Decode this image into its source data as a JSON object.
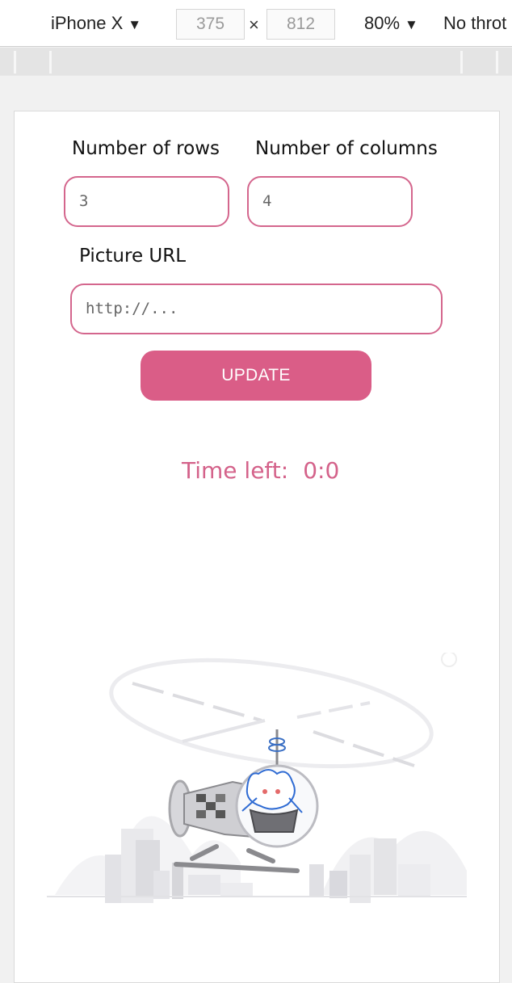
{
  "devtools": {
    "device": "iPhone X",
    "width": "375",
    "height": "812",
    "times": "×",
    "zoom": "80%",
    "throttle": "No throt",
    "caret": "▼"
  },
  "form": {
    "rows_label": "Number of rows",
    "rows_value": "3",
    "cols_label": "Number of columns",
    "cols_value": "4",
    "url_label": "Picture URL",
    "url_placeholder": "http://...",
    "update_label": "UPDATE"
  },
  "timer": {
    "label": "Time left:",
    "value": "0:0"
  },
  "illustration": {
    "icon": "octocat-helicopter-icon"
  },
  "colors": {
    "accent": "#da5d87",
    "accent_text": "#d4628a",
    "border": "#d4668d"
  }
}
